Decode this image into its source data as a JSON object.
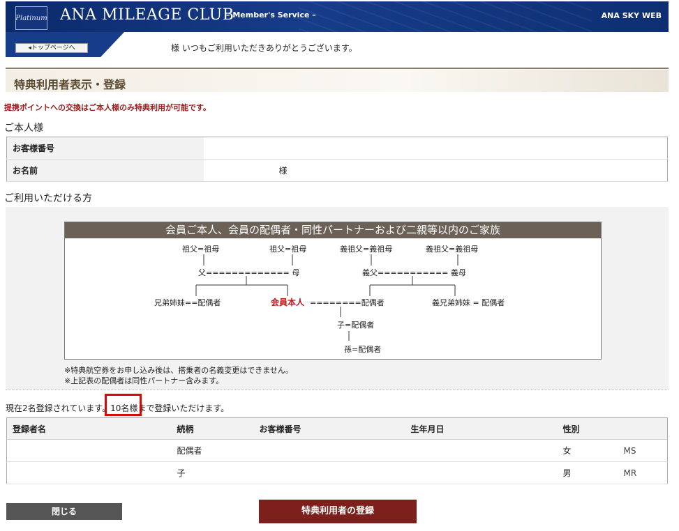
{
  "header": {
    "logo_text": "Platinum",
    "brand": "ANA MILEAGE CLUB",
    "brand_sub": "– Member's Service –",
    "right_label": "ANA SKY WEB"
  },
  "nav": {
    "top_page_label": "◂トップページへ"
  },
  "greeting": "様 いつもご利用いただきありがとうございます。",
  "section_title": "特典利用者表示・登録",
  "notice": "提携ポイントへの交換はご本人様のみ特典利用が可能です。",
  "self": {
    "heading": "ご本人様",
    "rows": [
      {
        "label": "お客様番号",
        "value": ""
      },
      {
        "label": "お名前",
        "value": "様"
      }
    ]
  },
  "users_heading": "ご利用いただける方",
  "diagram": {
    "title": "会員ご本人、会員の配偶者・同性パートナーおよび二親等以内のご家族",
    "nodes": {
      "gp1": "祖父=祖母",
      "gp2": "祖父=祖母",
      "igp1": "義祖父=義祖母",
      "igp2": "義祖父=義祖母",
      "parents": "父============= 母",
      "inlaw_parents": "義父=========== 義母",
      "siblings": "兄弟姉妹==配偶者",
      "self": "会員本人",
      "self_spouse": "========配偶者",
      "inlaw_siblings": "義兄弟姉妹 = 配偶者",
      "child": "子=配偶者",
      "grandchild": "孫=配偶者"
    },
    "notes": [
      "※特典航空券をお申し込み後は、搭乗者の名義変更はできません。",
      "※上記表の配偶者は同性パートナー含みます。"
    ]
  },
  "count_text": "現在2名登録されています。10名様まで登録いただけます。",
  "members": {
    "headers": [
      "登録者名",
      "続柄",
      "お客様番号",
      "生年月日",
      "性別",
      ""
    ],
    "rows": [
      [
        "",
        "配偶者",
        "",
        "",
        "女",
        "MS"
      ],
      [
        "",
        "子",
        "",
        "",
        "男",
        "MR"
      ]
    ]
  },
  "buttons": {
    "close": "閉じる",
    "register": "特典利用者の登録"
  }
}
